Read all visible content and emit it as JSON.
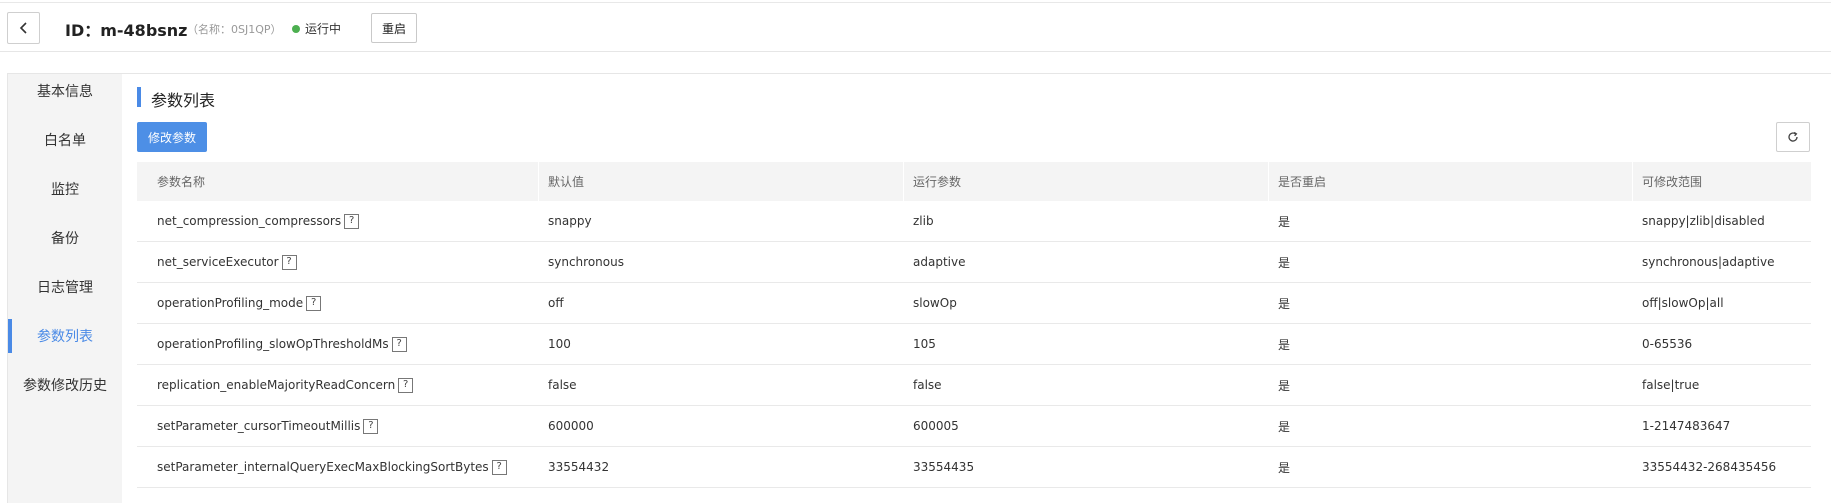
{
  "header": {
    "title": "ID：m-48bsnz",
    "subname": "（名称：0SJ1QP）",
    "status_text": "运行中",
    "status_color": "#4caf50",
    "restart_label": "重启",
    "back_icon": "chevron-left-icon"
  },
  "sidebar": {
    "items": [
      {
        "label": "基本信息"
      },
      {
        "label": "白名单"
      },
      {
        "label": "监控"
      },
      {
        "label": "备份"
      },
      {
        "label": "日志管理"
      },
      {
        "label": "参数列表"
      },
      {
        "label": "参数修改历史"
      }
    ],
    "active_index": 5,
    "accent_color": "#4a8ae6"
  },
  "main": {
    "section_title": "参数列表",
    "modify_label": "修改参数",
    "refresh_icon": "refresh-icon",
    "help_glyph": "?",
    "columns": [
      "参数名称",
      "默认值",
      "运行参数",
      "是否重启",
      "可修改范围"
    ],
    "rows": [
      {
        "name": "net_compression_compressors",
        "default": "snappy",
        "running": "zlib",
        "restart": "是",
        "range": "snappy|zlib|disabled"
      },
      {
        "name": "net_serviceExecutor",
        "default": "synchronous",
        "running": "adaptive",
        "restart": "是",
        "range": "synchronous|adaptive"
      },
      {
        "name": "operationProfiling_mode",
        "default": "off",
        "running": "slowOp",
        "restart": "是",
        "range": "off|slowOp|all"
      },
      {
        "name": "operationProfiling_slowOpThresholdMs",
        "default": "100",
        "running": "105",
        "restart": "是",
        "range": "0-65536"
      },
      {
        "name": "replication_enableMajorityReadConcern",
        "default": "false",
        "running": "false",
        "restart": "是",
        "range": "false|true"
      },
      {
        "name": "setParameter_cursorTimeoutMillis",
        "default": "600000",
        "running": "600005",
        "restart": "是",
        "range": "1-2147483647"
      },
      {
        "name": "setParameter_internalQueryExecMaxBlockingSortBytes",
        "default": "33554432",
        "running": "33554435",
        "restart": "是",
        "range": "33554432-268435456"
      }
    ]
  }
}
